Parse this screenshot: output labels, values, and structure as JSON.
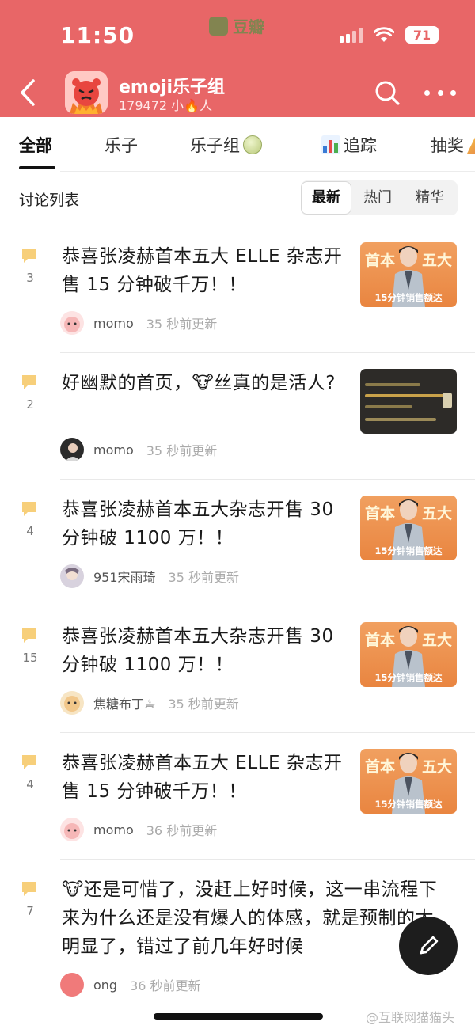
{
  "status_bar": {
    "time": "11:50",
    "carrier_label": "豆瓣",
    "battery": "71"
  },
  "header": {
    "group_name": "emoji乐子组",
    "member_count_prefix": "179472 小",
    "member_count_suffix": "人",
    "fire_emoji": "🔥",
    "accent_color": "#e86667"
  },
  "tabs": [
    {
      "label": "全部",
      "active": true
    },
    {
      "label": "乐子",
      "active": false
    },
    {
      "label": "乐子组",
      "active": false,
      "icon": "melon-icon"
    },
    {
      "label": "追踪",
      "active": false,
      "icon": "chart-icon"
    },
    {
      "label": "抽奖",
      "active": false,
      "icon": "party-icon"
    }
  ],
  "list_header": {
    "title": "讨论列表",
    "sort_options": [
      "最新",
      "热门",
      "精华"
    ],
    "selected_sort": "最新"
  },
  "posts": [
    {
      "reply_count": "3",
      "title": "恭喜张凌赫首本五大 ELLE 杂志开售 15 分钟破千万！！",
      "author": "momo",
      "time": "35 秒前更新",
      "thumb": "orange"
    },
    {
      "reply_count": "2",
      "title": "好幽默的首页，🐮丝真的是活人?",
      "author": "momo",
      "time": "35 秒前更新",
      "thumb": "dark"
    },
    {
      "reply_count": "4",
      "title": "恭喜张凌赫首本五大杂志开售 30 分钟破 1100 万！！",
      "author": "951宋雨琦",
      "time": "35 秒前更新",
      "thumb": "orange"
    },
    {
      "reply_count": "15",
      "title": "恭喜张凌赫首本五大杂志开售 30 分钟破 1100 万！！",
      "author": "焦糖布丁☕",
      "time": "35 秒前更新",
      "thumb": "orange"
    },
    {
      "reply_count": "4",
      "title": "恭喜张凌赫首本五大 ELLE 杂志开售 15 分钟破千万！！",
      "author": "momo",
      "time": "36 秒前更新",
      "thumb": "orange"
    },
    {
      "reply_count": "7",
      "title": "🐮还是可惜了，没赶上好时候，这一串流程下来为什么还是没有爆人的体感，就是预制的太明显了，错过了前几年好时候",
      "author": "ong",
      "time": "36 秒前更新",
      "thumb": "none"
    }
  ],
  "thumb_text": {
    "left_char": "首本",
    "right_char": "五大",
    "caption": "15分钟销售额达"
  },
  "watermark": "@互联网猫猫头"
}
